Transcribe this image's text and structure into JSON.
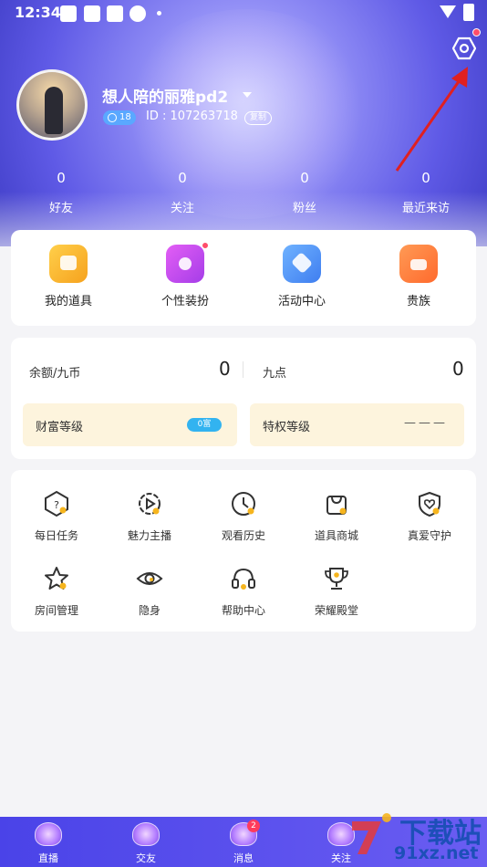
{
  "status_bar": {
    "time": "12:34"
  },
  "profile": {
    "username": "想人陪的丽雅pd2",
    "level": "18",
    "id_text": "ID : 107263718",
    "copy_label": "复制"
  },
  "stats": [
    {
      "value": "0",
      "label": "好友"
    },
    {
      "value": "0",
      "label": "关注"
    },
    {
      "value": "0",
      "label": "粉丝"
    },
    {
      "value": "0",
      "label": "最近来访"
    }
  ],
  "quick_actions": [
    {
      "label": "我的道具",
      "icon": "props-box-icon",
      "color": "#f6a91e"
    },
    {
      "label": "个性装扮",
      "icon": "magic-wand-icon",
      "color": "#c84cf2"
    },
    {
      "label": "活动中心",
      "icon": "tag-icon",
      "color": "#4f8df5"
    },
    {
      "label": "贵族",
      "icon": "crown-icon",
      "color": "#ff7a3d"
    }
  ],
  "balance": {
    "coins_label": "余额/九币",
    "coins_value": "0",
    "points_label": "九点",
    "points_value": "0"
  },
  "levels": {
    "wealth_label": "财富等级",
    "wealth_badge": "0富",
    "privilege_label": "特权等级",
    "privilege_value": "———"
  },
  "grid_items": [
    {
      "label": "每日任务",
      "icon": "daily-task-icon"
    },
    {
      "label": "魅力主播",
      "icon": "charm-host-icon"
    },
    {
      "label": "观看历史",
      "icon": "clock-icon"
    },
    {
      "label": "道具商城",
      "icon": "shopping-bag-icon"
    },
    {
      "label": "真爱守护",
      "icon": "heart-shield-icon"
    },
    {
      "label": "房间管理",
      "icon": "star-icon"
    },
    {
      "label": "隐身",
      "icon": "eye-icon"
    },
    {
      "label": "帮助中心",
      "icon": "headset-icon"
    },
    {
      "label": "荣耀殿堂",
      "icon": "trophy-icon"
    }
  ],
  "bottom_nav": [
    {
      "label": "直播",
      "icon": "live-icon"
    },
    {
      "label": "交友",
      "icon": "friends-icon"
    },
    {
      "label": "消息",
      "icon": "message-icon",
      "badge": "2"
    },
    {
      "label": "关注",
      "icon": "follow-icon"
    }
  ],
  "watermark": {
    "line1": "下载站",
    "line2": "91xz.net"
  },
  "colors": {
    "accent": "#5a53ea",
    "badge_red": "#ff4d6a",
    "highlight_yellow": "#f6b51e"
  }
}
